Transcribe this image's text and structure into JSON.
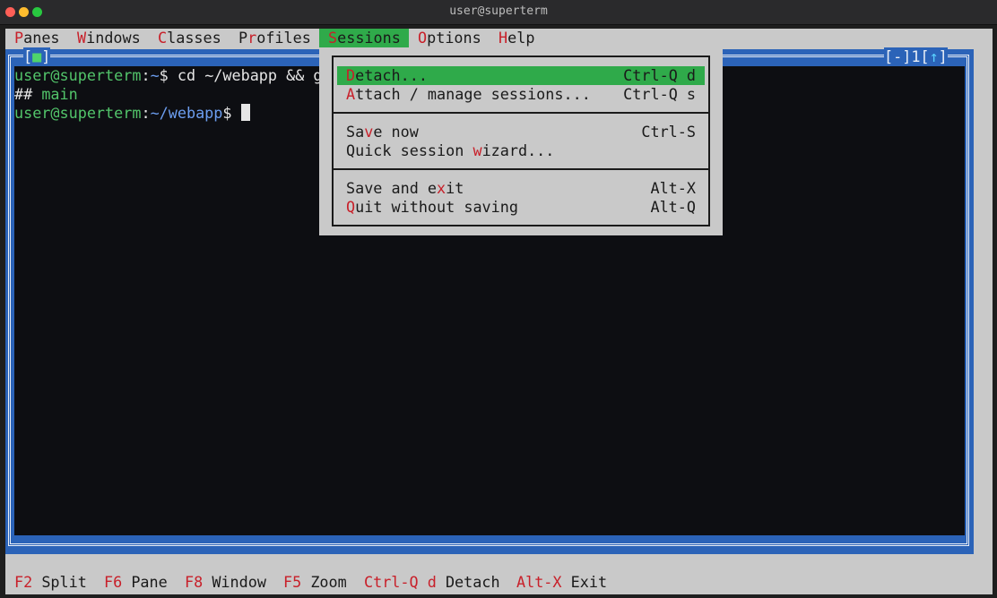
{
  "window": {
    "title": "user@superterm"
  },
  "menubar": {
    "items": [
      {
        "hot": "P",
        "rest": "anes"
      },
      {
        "hot": "W",
        "rest": "indows"
      },
      {
        "hot": "C",
        "rest": "lasses"
      },
      {
        "pre": "P",
        "hot": "r",
        "rest": "ofiles"
      },
      {
        "hot": "S",
        "rest": "essions"
      },
      {
        "hot": "O",
        "rest": "ptions"
      },
      {
        "hot": "H",
        "rest": "elp"
      }
    ]
  },
  "pane": {
    "tag_left_open": "[",
    "tag_left_icon": "■",
    "tag_left_close": "]",
    "tag_right_a": "[-]",
    "tag_right_num": "1",
    "tag_right_open": "[",
    "tag_right_arrow": "↑",
    "tag_right_close": "]"
  },
  "terminal": {
    "line1": {
      "user": "user@superterm",
      "sep": ":",
      "path": "~",
      "cmd": "$ cd ~/webapp && g"
    },
    "line2": {
      "prefix": "## ",
      "branch": "main"
    },
    "line3": {
      "user": "user@superterm",
      "sep": ":",
      "path": "~/webapp",
      "prompt": "$"
    }
  },
  "dropdown": {
    "items": [
      {
        "pre": "",
        "hot": "D",
        "post": "etach...",
        "shortcut": "Ctrl-Q d"
      },
      {
        "pre": "",
        "hot": "A",
        "post": "ttach / manage sessions...",
        "shortcut": "Ctrl-Q s"
      },
      {
        "pre": "Sa",
        "hot": "v",
        "post": "e now",
        "shortcut": "Ctrl-S"
      },
      {
        "pre": "Quick session ",
        "hot": "w",
        "post": "izard...",
        "shortcut": ""
      },
      {
        "pre": "Save and e",
        "hot": "x",
        "post": "it",
        "shortcut": "Alt-X"
      },
      {
        "pre": "",
        "hot": "Q",
        "post": "uit without saving",
        "shortcut": "Alt-Q"
      }
    ]
  },
  "statusbar": {
    "items": [
      {
        "key": "F2",
        "label": "Split"
      },
      {
        "key": "F6",
        "label": "Pane"
      },
      {
        "key": "F8",
        "label": "Window"
      },
      {
        "key": "F5",
        "label": "Zoom"
      },
      {
        "key": "Ctrl-Q d",
        "label": "Detach"
      },
      {
        "key": "Alt-X",
        "label": "Exit"
      }
    ]
  }
}
